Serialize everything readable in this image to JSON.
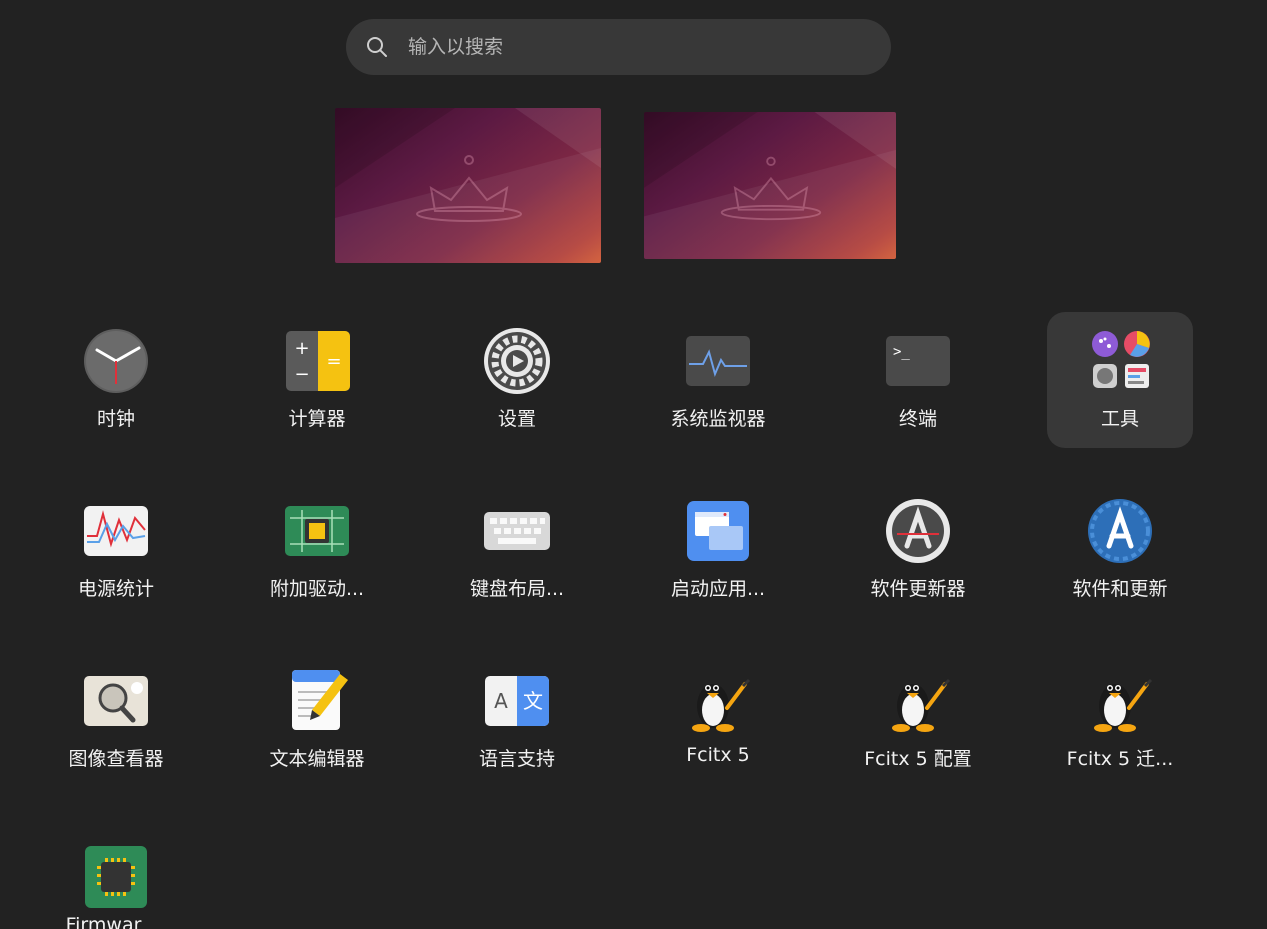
{
  "search": {
    "placeholder": "输入以搜索"
  },
  "workspaces": [
    {
      "name": "workspace-1"
    },
    {
      "name": "workspace-2"
    }
  ],
  "apps": [
    {
      "label": "时钟",
      "icon": "clock-icon"
    },
    {
      "label": "计算器",
      "icon": "calculator-icon"
    },
    {
      "label": "设置",
      "icon": "settings-gear-icon"
    },
    {
      "label": "系统监视器",
      "icon": "system-monitor-icon"
    },
    {
      "label": "终端",
      "icon": "terminal-icon"
    },
    {
      "label": "工具",
      "icon": "utilities-folder-icon",
      "selected": true
    },
    {
      "label": "电源统计",
      "icon": "power-statistics-icon"
    },
    {
      "label": "附加驱动...",
      "icon": "additional-drivers-chip-icon"
    },
    {
      "label": "键盘布局...",
      "icon": "keyboard-icon"
    },
    {
      "label": "启动应用...",
      "icon": "startup-apps-icon"
    },
    {
      "label": "软件更新器",
      "icon": "software-updater-icon"
    },
    {
      "label": "软件和更新",
      "icon": "software-and-updates-icon"
    },
    {
      "label": "图像查看器",
      "icon": "image-viewer-icon"
    },
    {
      "label": "文本编辑器",
      "icon": "text-editor-icon"
    },
    {
      "label": "语言支持",
      "icon": "language-support-icon"
    },
    {
      "label": "Fcitx 5",
      "icon": "tux-penguin-icon"
    },
    {
      "label": "Fcitx 5 配置",
      "icon": "tux-penguin-icon"
    },
    {
      "label": "Fcitx 5 迁...",
      "icon": "tux-penguin-icon"
    },
    {
      "label": "Firmwar",
      "icon": "firmware-chip-icon"
    }
  ],
  "colors": {
    "background": "#222222",
    "search_bg": "#383838",
    "selected_bg": "#383838"
  }
}
